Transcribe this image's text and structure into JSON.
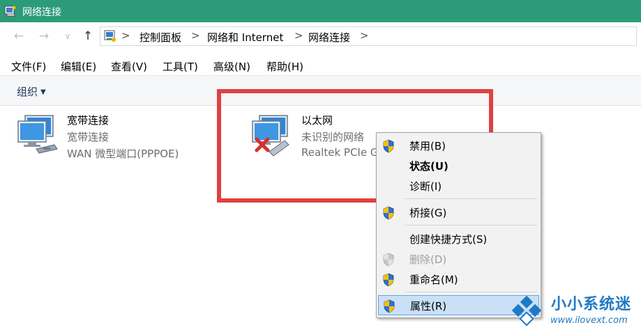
{
  "window": {
    "title": "网络连接"
  },
  "nav": {
    "back": "←",
    "forward": "→",
    "recent": "∨",
    "up": "↑"
  },
  "address": {
    "crumbs": [
      "控制面板",
      "网络和 Internet",
      "网络连接"
    ],
    "separator": ">"
  },
  "menubar": [
    "文件(F)",
    "编辑(E)",
    "查看(V)",
    "工具(T)",
    "高级(N)",
    "帮助(H)"
  ],
  "command_bar": {
    "organize": "组织",
    "caret": "▼"
  },
  "connections": [
    {
      "name": "宽带连接",
      "type": "宽带连接",
      "device": "WAN 微型端口(PPPOE)",
      "icon": "broadband-connection-icon"
    },
    {
      "name": "以太网",
      "type": "未识别的网络",
      "device": "Realtek PCIe G",
      "icon": "ethernet-disconnected-icon"
    }
  ],
  "context_menu": {
    "items": [
      {
        "label": "禁用(B)",
        "shield": true
      },
      {
        "label": "状态(U)",
        "bold": true
      },
      {
        "label": "诊断(I)"
      },
      {
        "label": "桥接(G)",
        "shield": true
      },
      {
        "label": "创建快捷方式(S)"
      },
      {
        "label": "删除(D)",
        "shield": true,
        "disabled": true
      },
      {
        "label": "重命名(M)",
        "shield": true
      },
      {
        "label": "属性(R)",
        "shield": true,
        "highlighted": true
      }
    ]
  },
  "watermark": {
    "name": "小小系统迷",
    "url": "www.ilovext.com"
  },
  "colors": {
    "titlebar": "#2d9b78",
    "highlight_box": "#e04040",
    "menu_hover": "#c9e0f7",
    "watermark": "#1f7ac4"
  }
}
